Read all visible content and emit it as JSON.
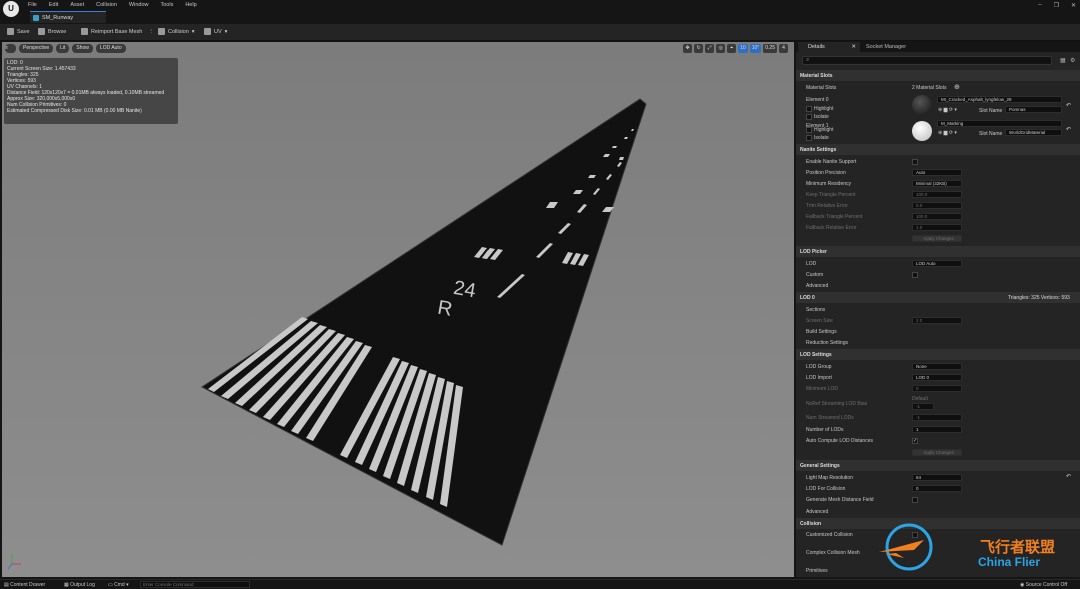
{
  "menu": [
    "File",
    "Edit",
    "Asset",
    "Collision",
    "Window",
    "Tools",
    "Help"
  ],
  "asset_tab": "SM_Runway",
  "toolbar": {
    "save": "Save",
    "browse": "Browse",
    "reimport": "Reimport Base Mesh",
    "collision": "Collision",
    "uv": "UV"
  },
  "viewport": {
    "perspective": "Perspective",
    "lit": "Lit",
    "show": "Show",
    "lod": "LOD Auto",
    "right": [
      "10",
      "10°",
      "0.25",
      "4"
    ],
    "stats": [
      "LOD: 0",
      "Current Screen Size: 1.457433",
      "Triangles: 325",
      "Vertices: 593",
      "UV Channels: 1",
      "Distance Field: 120x120x7 = 0.01MB always loaded, 0.10MB streamed",
      "Approx Size: 320,000x5,000x0",
      "Num Collision Primitives: 0",
      "Estimated Compressed Disk Size: 0.01 MB (0.00 MB Nanite)"
    ],
    "runway_number": "24",
    "runway_letter": "R"
  },
  "details": {
    "tab": "Details",
    "tab2": "Socket Manager",
    "material_slots": {
      "header": "Material Slots",
      "label": "Material Slots",
      "count": "2 Material Slots",
      "elements": [
        {
          "name": "Element 0",
          "material": "MI_Cracked_Asphalt_lyngfelow_28",
          "slot_label": "Slot Name",
          "slot": "Pomnas",
          "highlight": "Highlight",
          "isolate": "Isolate"
        },
        {
          "name": "Element 1",
          "material": "M_Marking",
          "slot_label": "Slot Name",
          "slot": "WorldGridMaterial",
          "highlight": "Highlight",
          "isolate": "Isolate"
        }
      ]
    },
    "nanite": {
      "header": "Nanite Settings",
      "enable": "Enable Nanite Support",
      "position_precision": "Position Precision",
      "position_value": "Auto",
      "min_res": "Minimum Residency",
      "min_res_value": "Minimal (32KB)",
      "keep_tri": "Keep Triangle Percent",
      "keep_tri_value": "100.0",
      "trim_error": "Trim Relative Error",
      "trim_value": "0.0",
      "fallback_tri": "Fallback Triangle Percent",
      "fallback_tri_value": "100.0",
      "fallback_err": "Fallback Relative Error",
      "fallback_err_value": "1.0",
      "apply": "Apply Changes"
    },
    "lod_picker": {
      "header": "LOD Picker",
      "lod": "LOD",
      "lod_value": "LOD Auto",
      "custom": "Custom",
      "advanced": "Advanced"
    },
    "lod0": {
      "header": "LOD 0",
      "stats": "Triangles: 325   Vertices: 593",
      "sections": "Sections",
      "screen_size": "Screen Size",
      "screen_value": "2.0",
      "build": "Build Settings",
      "reduction": "Reduction Settings"
    },
    "lod_settings": {
      "header": "LOD Settings",
      "group": "LOD Group",
      "group_value": "None",
      "import": "LOD Import",
      "import_value": "LOD 0",
      "min_lod": "Minimum LOD",
      "min_lod_value": "0",
      "no_ref": "NoRef Streaming LOD Bias",
      "no_ref_value": "Default",
      "no_ref_num": "-1",
      "num_streamed": "Num Streamed LODs",
      "num_streamed_value": "-1",
      "num_lods": "Number of LODs",
      "num_lods_value": "1",
      "auto_compute": "Auto Compute LOD Distances",
      "apply": "Apply Changes"
    },
    "general": {
      "header": "General Settings",
      "lightmap": "Light Map Resolution",
      "lightmap_value": "64",
      "lod_collision": "LOD For Collision",
      "lod_collision_value": "0",
      "gen_df": "Generate Mesh Distance Field",
      "advanced": "Advanced"
    },
    "collision": {
      "header": "Collision",
      "customized": "Customized Collision",
      "complex": "Complex Collision Mesh",
      "primitives": "Primitives"
    }
  },
  "status": {
    "content_drawer": "Content Drawer",
    "output_log": "Output Log",
    "cmd": "Cmd",
    "console_placeholder": "Enter Console Command",
    "source_control": "Source Control Off"
  },
  "watermark": {
    "cn": "飞行者联盟",
    "en": "China Flier"
  }
}
